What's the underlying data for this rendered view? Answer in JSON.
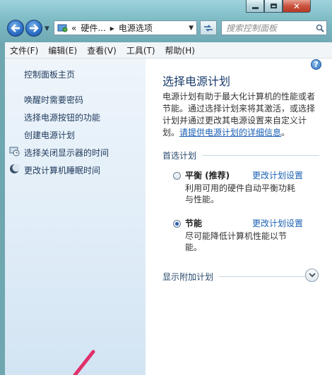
{
  "window": {
    "caption_buttons": {
      "min": "minimize-icon",
      "max": "maximize-icon",
      "close": "✕"
    }
  },
  "toolbar": {
    "back_icon": "back-arrow-icon",
    "forward_icon": "forward-arrow-icon",
    "address": {
      "overflow": "«",
      "crumbs": [
        "硬件...",
        "▸",
        "电源选项"
      ]
    },
    "search_placeholder": "搜索控制面板"
  },
  "menu": [
    "文件(F)",
    "编辑(E)",
    "查看(V)",
    "工具(T)",
    "帮助(H)"
  ],
  "sidebar": {
    "items": [
      {
        "label": "控制面板主页"
      },
      {
        "label": "唤醒时需要密码"
      },
      {
        "label": "选择电源按钮的功能"
      },
      {
        "label": "创建电源计划"
      },
      {
        "label": "选择关闭显示器的时间",
        "icon": "monitor-clock-icon"
      },
      {
        "label": "更改计算机睡眠时间",
        "icon": "moon-icon"
      }
    ]
  },
  "main": {
    "title": "选择电源计划",
    "description": "电源计划有助于最大化计算机的性能或者节能。通过选择计划来将其激活，或选择计划并通过更改其电源设置来自定义计划。",
    "details_link": "请提供电源计划的详细信息",
    "details_suffix": "。",
    "preferred_section": "首选计划",
    "plans": [
      {
        "name": "平衡 (推荐)",
        "change_link": "更改计划设置",
        "desc_line1": "利用可用的硬件自动平衡功耗",
        "desc_line2": "与性能。",
        "selected": false
      },
      {
        "name": "节能",
        "change_link": "更改计划设置",
        "desc_line1": "尽可能降低计算机性能以节",
        "desc_line2": "能。",
        "selected": true
      }
    ],
    "additional_section": "显示附加计划"
  },
  "colors": {
    "link": "#1a5fb4",
    "title": "#1b3d6c",
    "annotation_arrow": "#e0306a"
  }
}
